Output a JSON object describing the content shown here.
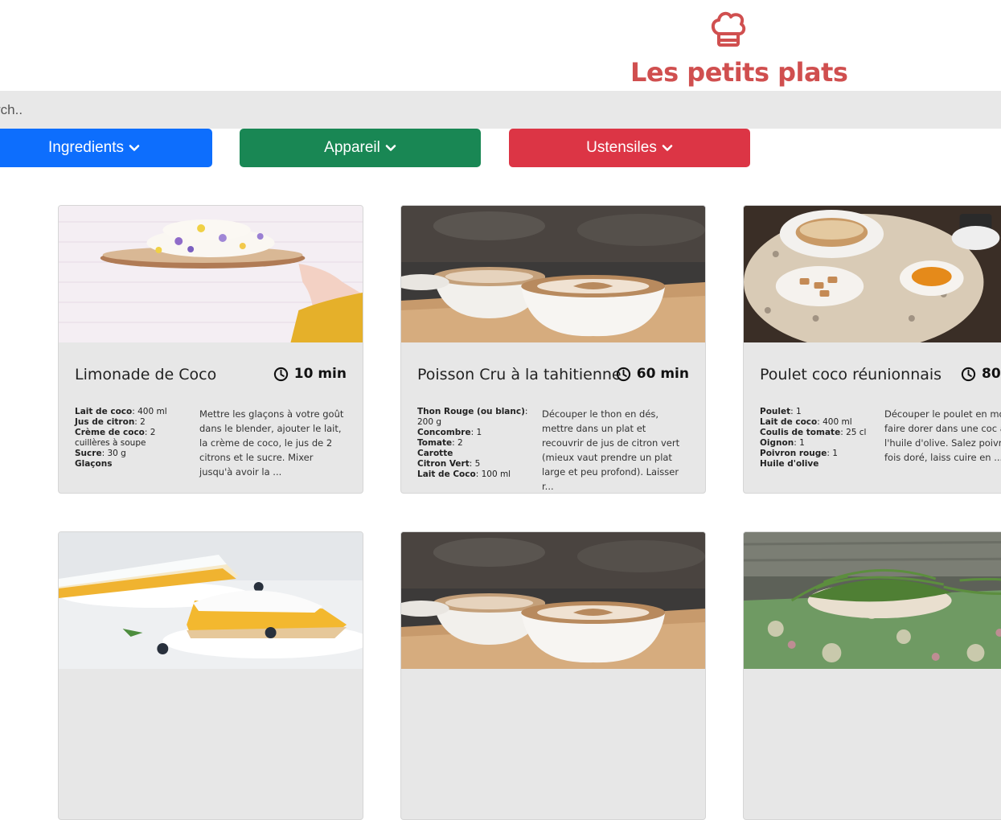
{
  "brand": {
    "title": "Les petits plats",
    "icon": "chef-hat-icon",
    "color": "#d04f4f"
  },
  "search": {
    "placeholder": "Rechercher une recette",
    "visible_placeholder": "rch.."
  },
  "filters": [
    {
      "label": "Ingredients",
      "color": "#0d6efd",
      "icon": "chevron-down-icon"
    },
    {
      "label": "Appareil",
      "color": "#198754",
      "icon": "chevron-down-icon"
    },
    {
      "label": "Ustensiles",
      "color": "#dc3545",
      "icon": "chevron-down-icon"
    }
  ],
  "recipes": [
    {
      "name": "Limonade de Coco",
      "time": "10 min",
      "ingredients": [
        {
          "name": "Lait de coco",
          "qty": ": 400 ml"
        },
        {
          "name": "Jus de citron",
          "qty": ": 2"
        },
        {
          "name": "Crème de coco",
          "qty": ": 2 cuillères à soupe"
        },
        {
          "name": "Sucre",
          "qty": ": 30 g"
        },
        {
          "name": "Glaçons",
          "qty": ""
        }
      ],
      "description": "Mettre les glaçons à votre goût dans le blender, ajouter le lait, la crème de coco, le jus de 2 citrons et le sucre. Mixer jusqu'à avoir la ..."
    },
    {
      "name": "Poisson Cru à la tahitienne",
      "time": "60 min",
      "ingredients": [
        {
          "name": "Thon Rouge (ou blanc)",
          "qty": ": 200 g"
        },
        {
          "name": "Concombre",
          "qty": ": 1"
        },
        {
          "name": "Tomate",
          "qty": ": 2"
        },
        {
          "name": "Carotte",
          "qty": ""
        },
        {
          "name": "Citron Vert",
          "qty": ": 5"
        },
        {
          "name": "Lait de Coco",
          "qty": ": 100 ml"
        }
      ],
      "description": "Découper le thon en dés, mettre dans un plat et recouvrir de jus de citron vert (mieux vaut prendre un plat large et peu profond). Laisser r..."
    },
    {
      "name": "Poulet coco réunionnais",
      "time": "80",
      "ingredients": [
        {
          "name": "Poulet",
          "qty": ": 1"
        },
        {
          "name": "Lait de coco",
          "qty": ": 400 ml"
        },
        {
          "name": "Coulis de tomate",
          "qty": ": 25 cl"
        },
        {
          "name": "Oignon",
          "qty": ": 1"
        },
        {
          "name": "Poivron rouge",
          "qty": ": 1"
        },
        {
          "name": "Huile d'olive",
          "qty": ""
        }
      ],
      "description": "Découper le poulet en morc les faire dorer dans une coc avec de l'huile d'olive. Salez poivrez. Une fois doré, laiss cuire en ..."
    },
    {
      "name": "",
      "time": "",
      "ingredients": [],
      "description": ""
    },
    {
      "name": "",
      "time": "",
      "ingredients": [],
      "description": ""
    },
    {
      "name": "",
      "time": "",
      "ingredients": [],
      "description": ""
    }
  ]
}
